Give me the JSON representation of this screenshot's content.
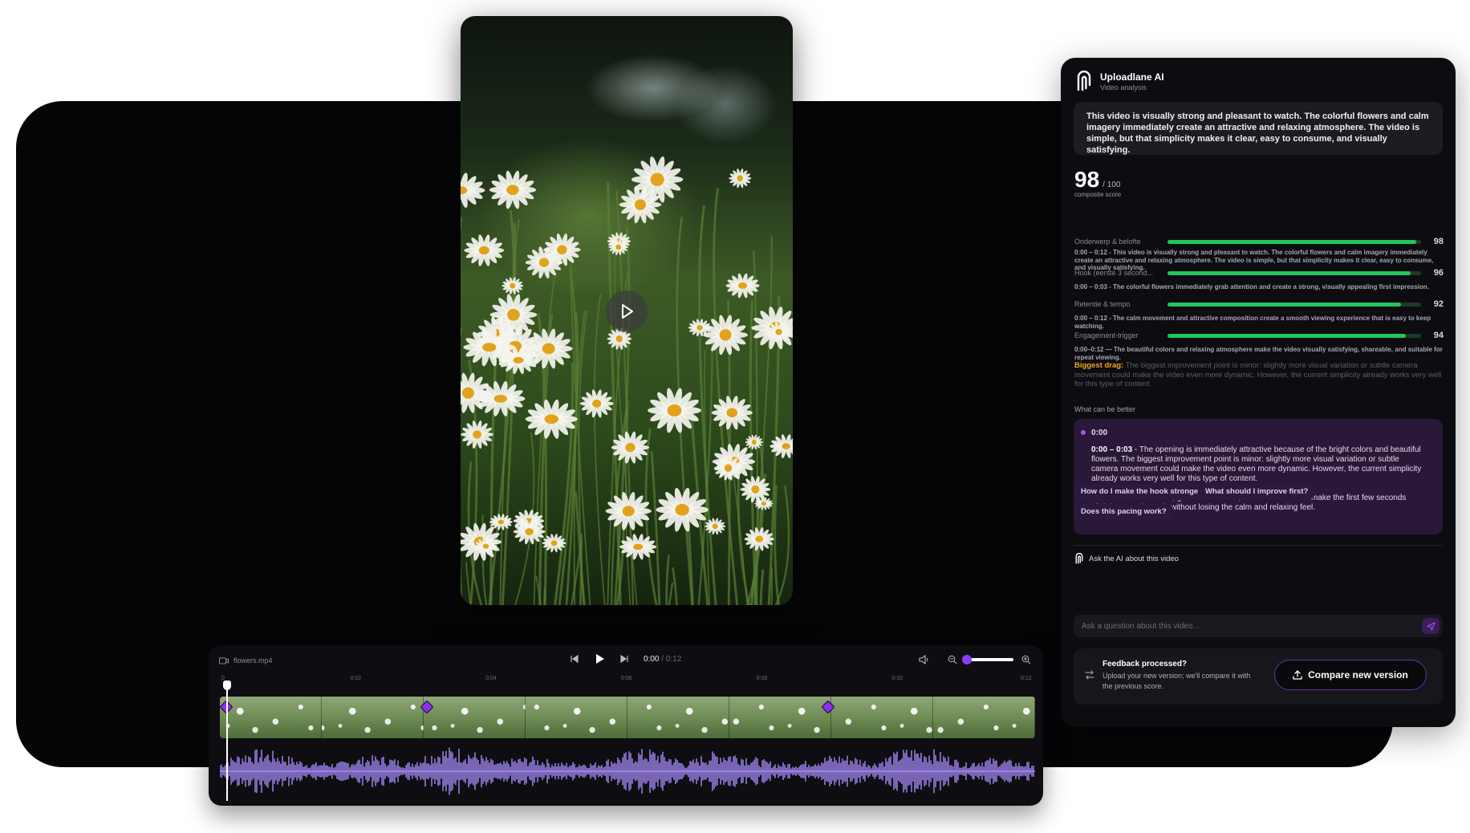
{
  "panel": {
    "title": "Uploadlane AI",
    "subtitle": "Video analysis",
    "summary": "This video is visually strong and pleasant to watch. The colorful flowers and calm imagery immediately create an attractive and relaxing atmosphere. The video is simple, but that simplicity makes it clear, easy to consume, and visually satisfying.",
    "score": "98",
    "score_max": "/ 100",
    "score_label": "composite score",
    "metrics": [
      {
        "name": "Onderwerp & belofte",
        "value": "98",
        "fill": 0.98,
        "note": "0:00 – 0:12 - This video is visually strong and pleasant to watch. The colorful flowers and calm imagery immediately create an attractive and relaxing atmosphere. The video is simple, but that simplicity makes it clear, easy to consume, and visually satisfying."
      },
      {
        "name": "Hook (eerste 3 second...",
        "value": "96",
        "fill": 0.96,
        "note": "0:00 – 0:03 - The colorful flowers immediately grab attention and create a strong, visually appealing first impression."
      },
      {
        "name": "Retentie & tempo",
        "value": "92",
        "fill": 0.92,
        "note": "0:00 – 0:12 - The calm movement and attractive composition create a smooth viewing experience that is easy to keep watching."
      },
      {
        "name": "Engagement-trigger",
        "value": "94",
        "fill": 0.94,
        "note": "0:00–0:12 — The beautiful colors and relaxing atmosphere make the video visually satisfying, shareable, and suitable for repeat viewing."
      }
    ],
    "drag_label": "Biggest drag:",
    "drag_text": "The biggest improvement point is minor: slightly more visual variation or subtle camera movement could make the video even more dynamic. However, the current simplicity already works very well for this type of content.",
    "better_label": "What can be better",
    "fix_time": "0:00",
    "fix_range": "0:00 – 0:03",
    "fix_text": " - The opening is immediately attractive because of the bright colors and beautiful flowers. The biggest improvement point is minor: slightly more visual variation or subtle camera movement could make the video even more dynamic. However, the current simplicity already works very well for this type of content.",
    "fix_label": "Fix:",
    "fix_action": " Add a subtle zoom, gentle movement, or soft transition to make the first few seconds slightly more dynamic without losing the calm and relaxing feel.",
    "ask_title": "Ask the AI about this video",
    "chips": [
      "How do I make the hook stronger?",
      "What should I improve first?",
      "Does this pacing work?"
    ],
    "ask_placeholder": "Ask a question about this video...",
    "feedback_title": "Feedback processed?",
    "feedback_sub": "Upload your new version; we'll compare it with the previous score.",
    "compare_label": "Compare new version"
  },
  "editor": {
    "filename": "flowers.mp4",
    "current_time": "0:00",
    "duration": "/ 0:12",
    "zoom_level": 0.0,
    "ticks": [
      "0",
      "0:02",
      "0:04",
      "0:06",
      "0:08",
      "0:10",
      "0:12"
    ],
    "markers_seconds": [
      0,
      3,
      9
    ]
  },
  "colors": {
    "accent": "#8b2ff2",
    "score_bar": "#22c55e",
    "drag_label": "#f5a524",
    "waveform": "#a78bfa"
  }
}
